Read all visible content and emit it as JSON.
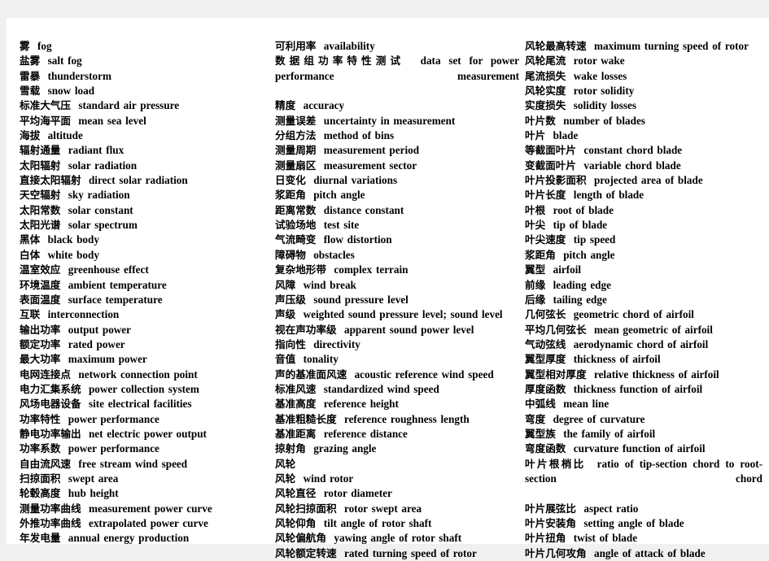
{
  "document": {
    "type": "bilingual-glossary",
    "title": "",
    "language_pair": "Chinese-English",
    "subject": "wind turbine terminology",
    "page_background": "#ffffff",
    "surround_background": "#f0f0f0",
    "text_color": "#000000",
    "columns": [
      {
        "id": "col-1",
        "entries": [
          {
            "zh": "雾",
            "en": "fog"
          },
          {
            "zh": "盐雾",
            "en": "salt fog"
          },
          {
            "zh": "雷暴",
            "en": "thunderstorm"
          },
          {
            "zh": "雪载",
            "en": "snow load"
          },
          {
            "zh": "标准大气压",
            "en": "standard air pressure"
          },
          {
            "zh": "平均海平面",
            "en": "mean sea level"
          },
          {
            "zh": "海拔",
            "en": "altitude"
          },
          {
            "zh": "辐射通量",
            "en": "radiant flux"
          },
          {
            "zh": "太阳辐射",
            "en": "solar radiation"
          },
          {
            "zh": "直接太阳辐射",
            "en": "direct solar radiation"
          },
          {
            "zh": "天空辐射",
            "en": "sky radiation"
          },
          {
            "zh": "太阳常数",
            "en": "solar constant"
          },
          {
            "zh": "太阳光谱",
            "en": "solar spectrum"
          },
          {
            "zh": "黑体",
            "en": "black body"
          },
          {
            "zh": "白体",
            "en": "white body"
          },
          {
            "zh": "温室效应",
            "en": "greenhouse effect"
          },
          {
            "zh": "环境温度",
            "en": "ambient temperature"
          },
          {
            "zh": "表面温度",
            "en": "surface temperature"
          },
          {
            "zh": "互联",
            "en": "interconnection"
          },
          {
            "zh": "输出功率",
            "en": "output power"
          },
          {
            "zh": "额定功率",
            "en": "rated power"
          },
          {
            "zh": "最大功率",
            "en": "maximum power"
          },
          {
            "zh": "电网连接点",
            "en": "network connection point"
          },
          {
            "zh": "电力汇集系统",
            "en": "power collection system"
          },
          {
            "zh": "风场电器设备",
            "en": "site electrical facilities"
          },
          {
            "zh": "功率特性",
            "en": "power performance"
          },
          {
            "zh": "静电功率输出",
            "en": "net electric power output"
          },
          {
            "zh": "功率系数",
            "en": "power performance"
          },
          {
            "zh": "自由流风速",
            "en": "free stream wind speed"
          },
          {
            "zh": "扫掠面积",
            "en": "swept area"
          },
          {
            "zh": "轮毂高度",
            "en": "hub height"
          },
          {
            "zh": "测量功率曲线",
            "en": "measurement power curve"
          },
          {
            "zh": "外推功率曲线",
            "en": "extrapolated power curve"
          },
          {
            "zh": "年发电量",
            "en": "annual energy production"
          }
        ]
      },
      {
        "id": "col-2",
        "entries": [
          {
            "zh": "可利用率",
            "en": "availability"
          },
          {
            "zh": "数据组功率特性测试",
            "en": "data set for power performance measurement",
            "wrap": true
          },
          {
            "zh": "精度",
            "en": "accuracy"
          },
          {
            "zh": "测量误差",
            "en": "uncertainty in measurement"
          },
          {
            "zh": "分组方法",
            "en": "method of bins"
          },
          {
            "zh": "测量周期",
            "en": "measurement period"
          },
          {
            "zh": "测量扇区",
            "en": "measurement sector"
          },
          {
            "zh": "日变化",
            "en": "diurnal variations"
          },
          {
            "zh": "浆距角",
            "en": "pitch angle"
          },
          {
            "zh": "距离常数",
            "en": "distance constant"
          },
          {
            "zh": "试验场地",
            "en": "test site"
          },
          {
            "zh": "气流畸变",
            "en": "flow distortion"
          },
          {
            "zh": "障碍物",
            "en": "obstacles"
          },
          {
            "zh": "复杂地形带",
            "en": "complex terrain"
          },
          {
            "zh": "风障",
            "en": "wind break"
          },
          {
            "zh": "声压级",
            "en": "sound pressure level"
          },
          {
            "zh": "声级",
            "en": "weighted sound pressure level; sound level"
          },
          {
            "zh": "视在声功率级",
            "en": "apparent sound power level"
          },
          {
            "zh": "指向性",
            "en": "directivity"
          },
          {
            "zh": "音值",
            "en": "tonality"
          },
          {
            "zh": "声的基准面风速",
            "en": "acoustic reference wind speed"
          },
          {
            "zh": "标准风速",
            "en": "standardized wind speed"
          },
          {
            "zh": "基准高度",
            "en": "reference height"
          },
          {
            "zh": "基准粗糙长度",
            "en": "reference roughness length"
          },
          {
            "zh": "基准距离",
            "en": "reference distance"
          },
          {
            "zh": "掠射角",
            "en": "grazing angle"
          },
          {
            "zh": "风轮",
            "en": ""
          },
          {
            "zh": "风轮",
            "en": "wind rotor"
          },
          {
            "zh": "风轮直径",
            "en": "rotor diameter"
          },
          {
            "zh": "风轮扫掠面积",
            "en": "rotor swept area"
          },
          {
            "zh": "风轮仰角",
            "en": "tilt angle of rotor shaft"
          },
          {
            "zh": "风轮偏航角",
            "en": "yawing angle of rotor shaft"
          },
          {
            "zh": "风轮额定转速",
            "en": "rated turning speed of rotor"
          }
        ]
      },
      {
        "id": "col-3",
        "entries": [
          {
            "zh": "风轮最高转速",
            "en": "maximum turning speed of rotor"
          },
          {
            "zh": "风轮尾流",
            "en": "rotor wake"
          },
          {
            "zh": "尾流损失",
            "en": "wake losses"
          },
          {
            "zh": "风轮实度",
            "en": "rotor solidity"
          },
          {
            "zh": "实度损失",
            "en": "solidity losses"
          },
          {
            "zh": "叶片数",
            "en": "number of blades"
          },
          {
            "zh": "叶片",
            "en": "blade"
          },
          {
            "zh": "等截面叶片",
            "en": "constant chord blade"
          },
          {
            "zh": "变截面叶片",
            "en": "variable chord blade"
          },
          {
            "zh": "叶片投影面积",
            "en": "projected area of blade"
          },
          {
            "zh": "叶片长度",
            "en": "length of blade"
          },
          {
            "zh": "叶根",
            "en": "root of blade"
          },
          {
            "zh": "叶尖",
            "en": "tip of blade"
          },
          {
            "zh": "叶尖速度",
            "en": "tip speed"
          },
          {
            "zh": "浆距角",
            "en": "pitch angle"
          },
          {
            "zh": "翼型",
            "en": "airfoil"
          },
          {
            "zh": "前缘",
            "en": "leading edge"
          },
          {
            "zh": "后缘",
            "en": "tailing edge"
          },
          {
            "zh": "几何弦长",
            "en": "geometric chord of airfoil"
          },
          {
            "zh": "平均几何弦长",
            "en": "mean geometric of airfoil"
          },
          {
            "zh": "气动弦线",
            "en": "aerodynamic chord of airfoil"
          },
          {
            "zh": "翼型厚度",
            "en": "thickness of airfoil"
          },
          {
            "zh": "翼型相对厚度",
            "en": "relative thickness of airfoil"
          },
          {
            "zh": "厚度函数",
            "en": "thickness function of airfoil"
          },
          {
            "zh": "中弧线",
            "en": "mean line"
          },
          {
            "zh": "弯度",
            "en": "degree of curvature"
          },
          {
            "zh": "翼型族",
            "en": "the family of airfoil"
          },
          {
            "zh": "弯度函数",
            "en": "curvature function of airfoil"
          },
          {
            "zh": "叶片根梢比",
            "en": "ratio of tip-section chord to root-section chord",
            "wrap": true
          },
          {
            "zh": "叶片展弦比",
            "en": "aspect ratio"
          },
          {
            "zh": "叶片安装角",
            "en": "setting angle of blade"
          },
          {
            "zh": "叶片扭角",
            "en": "twist of blade"
          },
          {
            "zh": "叶片几何攻角",
            "en": "angle of attack of blade"
          }
        ]
      }
    ]
  }
}
